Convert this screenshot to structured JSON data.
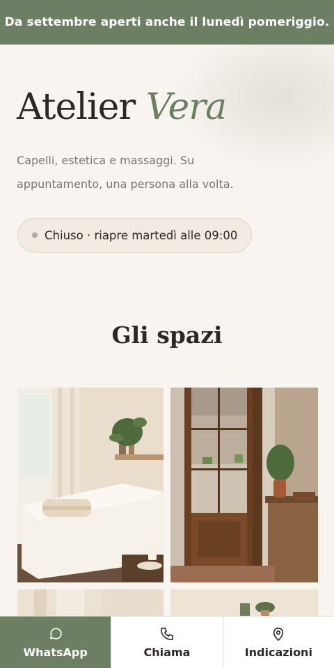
{
  "banner": {
    "text": "Da settembre aperti anche il lunedì pomeriggio."
  },
  "hero": {
    "title_main": "Atelier",
    "title_accent": "Vera",
    "lede": "Capelli, estetica e massaggi. Su appuntamento, una persona alla volta.",
    "status_text": "Chiuso · riapre martedì alle 09:00"
  },
  "spaces": {
    "title": "Gli spazi",
    "images": [
      {
        "alt": "Stanza massaggi con lettino e piante"
      },
      {
        "alt": "Porta in legno aperta su un vicolo"
      },
      {
        "alt": "Spazio interno"
      },
      {
        "alt": "Spazio interno"
      }
    ]
  },
  "actions": [
    {
      "label": "WhatsApp",
      "icon": "chat-bubble-icon"
    },
    {
      "label": "Chiama",
      "icon": "phone-icon"
    },
    {
      "label": "Indicazioni",
      "icon": "map-pin-icon"
    }
  ],
  "colors": {
    "accent": "#6d7f62",
    "background": "#f8f5f0",
    "text": "#2b2926"
  }
}
